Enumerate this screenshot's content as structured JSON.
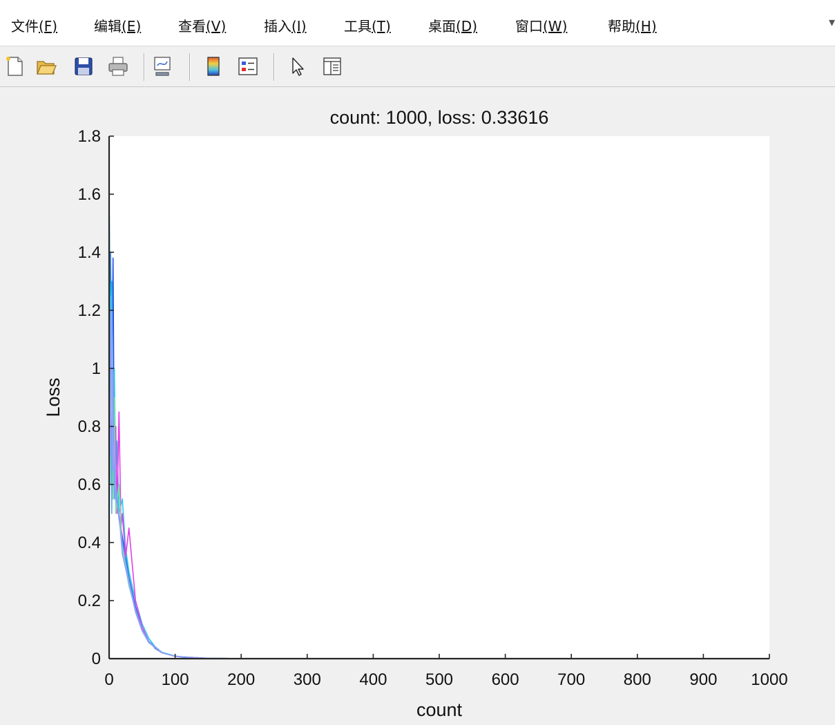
{
  "menu": {
    "items": [
      {
        "label": "文件",
        "mnemonic": "(F)"
      },
      {
        "label": "编辑",
        "mnemonic": "(E)"
      },
      {
        "label": "查看",
        "mnemonic": "(V)"
      },
      {
        "label": "插入",
        "mnemonic": "(I)"
      },
      {
        "label": "工具",
        "mnemonic": "(T)"
      },
      {
        "label": "桌面",
        "mnemonic": "(D)"
      },
      {
        "label": "窗口",
        "mnemonic": "(W)"
      },
      {
        "label": "帮助",
        "mnemonic": "(H)"
      }
    ],
    "overflow": "▾"
  },
  "toolbar": {
    "buttons": [
      "new-figure-icon",
      "open-file-icon",
      "save-icon",
      "print-icon",
      "link-plot-icon",
      "colorbar-icon",
      "legend-icon",
      "pointer-icon",
      "property-editor-icon"
    ]
  },
  "chart_data": {
    "type": "line",
    "title": "count: 1000, loss: 0.33616",
    "xlabel": "count",
    "ylabel": "Loss",
    "xlim": [
      0,
      1000
    ],
    "ylim": [
      0,
      1.8
    ],
    "xticks": [
      0,
      100,
      200,
      300,
      400,
      500,
      600,
      700,
      800,
      900,
      1000
    ],
    "yticks": [
      0,
      0.2,
      0.4,
      0.6,
      0.8,
      1,
      1.2,
      1.4,
      1.6,
      1.8
    ],
    "ytick_labels": [
      "0",
      "0.2",
      "0.4",
      "0.6",
      "0.8",
      "1",
      "1.2",
      "1.4",
      "1.6",
      "1.8"
    ],
    "grid": false,
    "colors": {
      "series_a": "#1f4fe0",
      "series_b": "#28c8e8",
      "series_c": "#e040e8",
      "series_d": "#7fe0a0",
      "series_e": "#60a8f0",
      "series_f": "#9aa0f8",
      "axis": "#262626"
    },
    "series": [
      {
        "x": [
          0,
          2,
          4,
          6,
          8,
          10,
          12,
          15,
          20,
          25,
          30,
          40,
          50,
          60,
          70,
          80,
          100,
          120,
          150,
          200,
          300
        ],
        "y": [
          0.5,
          1.4,
          0.9,
          1.38,
          0.6,
          0.7,
          0.55,
          0.5,
          0.42,
          0.35,
          0.28,
          0.18,
          0.1,
          0.06,
          0.035,
          0.02,
          0.008,
          0.003,
          0.001,
          0.0003,
          0.0001
        ]
      },
      {
        "x": [
          0,
          2,
          4,
          6,
          8,
          10,
          12,
          15,
          20,
          25,
          30,
          40,
          50,
          60,
          70,
          80,
          100,
          120,
          150,
          200,
          300
        ],
        "y": [
          1.6,
          1.1,
          1.3,
          0.8,
          1.0,
          0.6,
          0.75,
          0.5,
          0.55,
          0.38,
          0.3,
          0.2,
          0.12,
          0.07,
          0.04,
          0.022,
          0.009,
          0.004,
          0.001,
          0.0003,
          0.0001
        ]
      },
      {
        "x": [
          0,
          2,
          4,
          6,
          8,
          10,
          12,
          15,
          18,
          20,
          25,
          30,
          40,
          50,
          60,
          80,
          100,
          150,
          200,
          300
        ],
        "y": [
          0.6,
          0.9,
          0.7,
          1.0,
          0.65,
          0.8,
          0.5,
          0.85,
          0.45,
          0.5,
          0.35,
          0.45,
          0.2,
          0.11,
          0.06,
          0.02,
          0.008,
          0.001,
          0.0003,
          0.0001
        ]
      },
      {
        "x": [
          0,
          2,
          4,
          6,
          8,
          10,
          15,
          20,
          30,
          40,
          50,
          60,
          80,
          100,
          150,
          200,
          300
        ],
        "y": [
          1.2,
          0.6,
          1.15,
          0.55,
          0.9,
          0.5,
          0.6,
          0.38,
          0.25,
          0.17,
          0.1,
          0.055,
          0.02,
          0.008,
          0.001,
          0.0003,
          0.0001
        ]
      },
      {
        "x": [
          0,
          2,
          4,
          6,
          8,
          10,
          15,
          20,
          30,
          40,
          50,
          60,
          80,
          100,
          150,
          200,
          300
        ],
        "y": [
          0.4,
          1.25,
          0.5,
          1.0,
          0.55,
          0.6,
          0.48,
          0.4,
          0.27,
          0.17,
          0.1,
          0.06,
          0.021,
          0.008,
          0.001,
          0.0003,
          0.0001
        ]
      },
      {
        "x": [
          0,
          2,
          4,
          6,
          8,
          10,
          15,
          20,
          30,
          40,
          50,
          60,
          80,
          100,
          150,
          200,
          300
        ],
        "y": [
          1.0,
          0.7,
          1.2,
          0.65,
          0.75,
          0.55,
          0.5,
          0.36,
          0.26,
          0.16,
          0.095,
          0.055,
          0.02,
          0.008,
          0.001,
          0.0003,
          0.0001
        ]
      }
    ]
  }
}
